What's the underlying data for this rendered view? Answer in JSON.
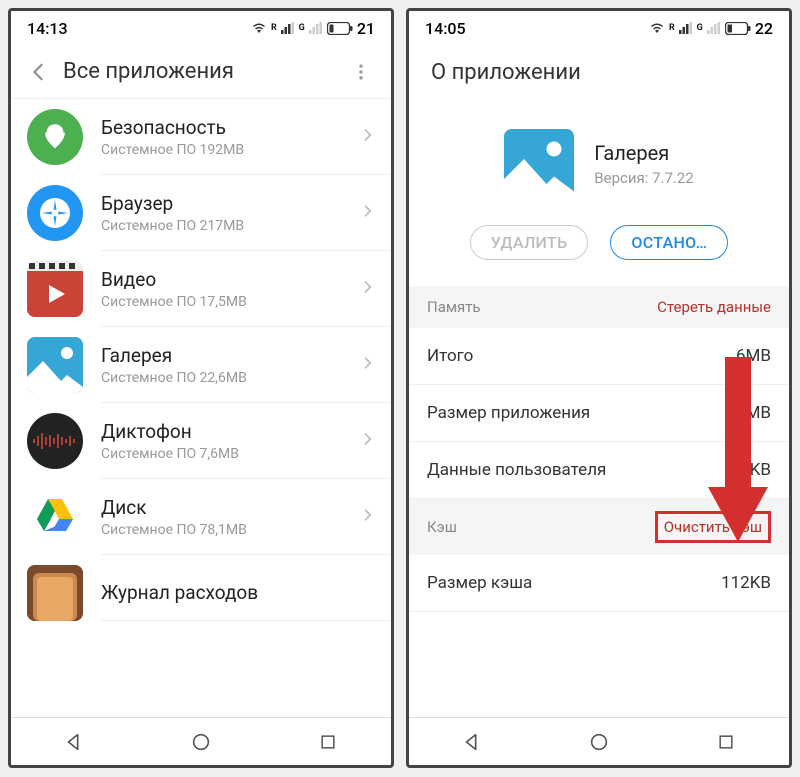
{
  "left": {
    "status": {
      "time": "14:13",
      "battery": "21"
    },
    "header": {
      "title": "Все приложения"
    },
    "apps": [
      {
        "name": "Безопасность",
        "sub": "Системное ПО   192MB"
      },
      {
        "name": "Браузер",
        "sub": "Системное ПО   217MB"
      },
      {
        "name": "Видео",
        "sub": "Системное ПО   17,5MB"
      },
      {
        "name": "Галерея",
        "sub": "Системное ПО   22,6MB"
      },
      {
        "name": "Диктофон",
        "sub": "Системное ПО   7,6MB"
      },
      {
        "name": "Диск",
        "sub": "Системное ПО   78,1MB"
      },
      {
        "name": "Журнал расходов",
        "sub": ""
      }
    ]
  },
  "right": {
    "status": {
      "time": "14:05",
      "battery": "22"
    },
    "header": {
      "title": "О приложении"
    },
    "app": {
      "name": "Галерея",
      "version": "Версия: 7.7.22"
    },
    "buttons": {
      "delete": "УДАЛИТЬ",
      "stop": "ОСТАНО…"
    },
    "memory": {
      "title": "Память",
      "action": "Стереть данные",
      "rows": [
        {
          "label": "Итого",
          "value": "6MB"
        },
        {
          "label": "Размер приложения",
          "value": "MB"
        },
        {
          "label": "Данные пользователя",
          "value": "96KB"
        }
      ]
    },
    "cache": {
      "title": "Кэш",
      "action": "Очистить кэш",
      "rows": [
        {
          "label": "Размер кэша",
          "value": "112KB"
        }
      ]
    }
  }
}
